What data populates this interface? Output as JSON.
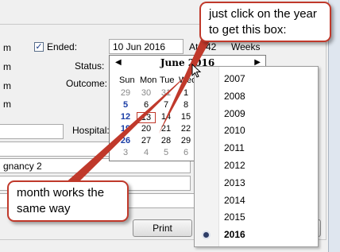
{
  "form": {
    "row_prefix_1": "m",
    "row_prefix_2": "m",
    "row_prefix_3": "m",
    "row_prefix_4": "m",
    "ended_label": "Ended:",
    "ended_checked": true,
    "ended_date": "10 Jun 2016",
    "at_label": "At:",
    "at_value": "42",
    "weeks_label": "Weeks",
    "status_label": "Status:",
    "outcome_label": "Outcome:",
    "hospital_label": "Hospital:",
    "pregnancy_text": "gnancy 2",
    "print_label": "Print",
    "cancel_label": "ncel"
  },
  "calendar": {
    "title": "June 2016",
    "prev_arrow": "◀",
    "next_arrow": "▶",
    "dow": [
      "Sun",
      "Mon",
      "Tue",
      "Wed"
    ],
    "weeks": [
      [
        "29",
        "30",
        "31",
        "1"
      ],
      [
        "5",
        "6",
        "7",
        "8"
      ],
      [
        "12",
        "13",
        "14",
        "15"
      ],
      [
        "19",
        "20",
        "21",
        "22"
      ],
      [
        "26",
        "27",
        "28",
        "29"
      ],
      [
        "3",
        "4",
        "5",
        "6"
      ]
    ],
    "today": "13"
  },
  "year_list": {
    "years": [
      "2007",
      "2008",
      "2009",
      "2010",
      "2011",
      "2012",
      "2013",
      "2014",
      "2015",
      "2016"
    ],
    "selected": "2016"
  },
  "callouts": {
    "top": "just click on the year to get this box:",
    "bottom": "month works the same way"
  },
  "colors": {
    "callout_border": "#c0392b",
    "weekend_blue": "#1b3ea6",
    "today_border": "#c0392b"
  }
}
